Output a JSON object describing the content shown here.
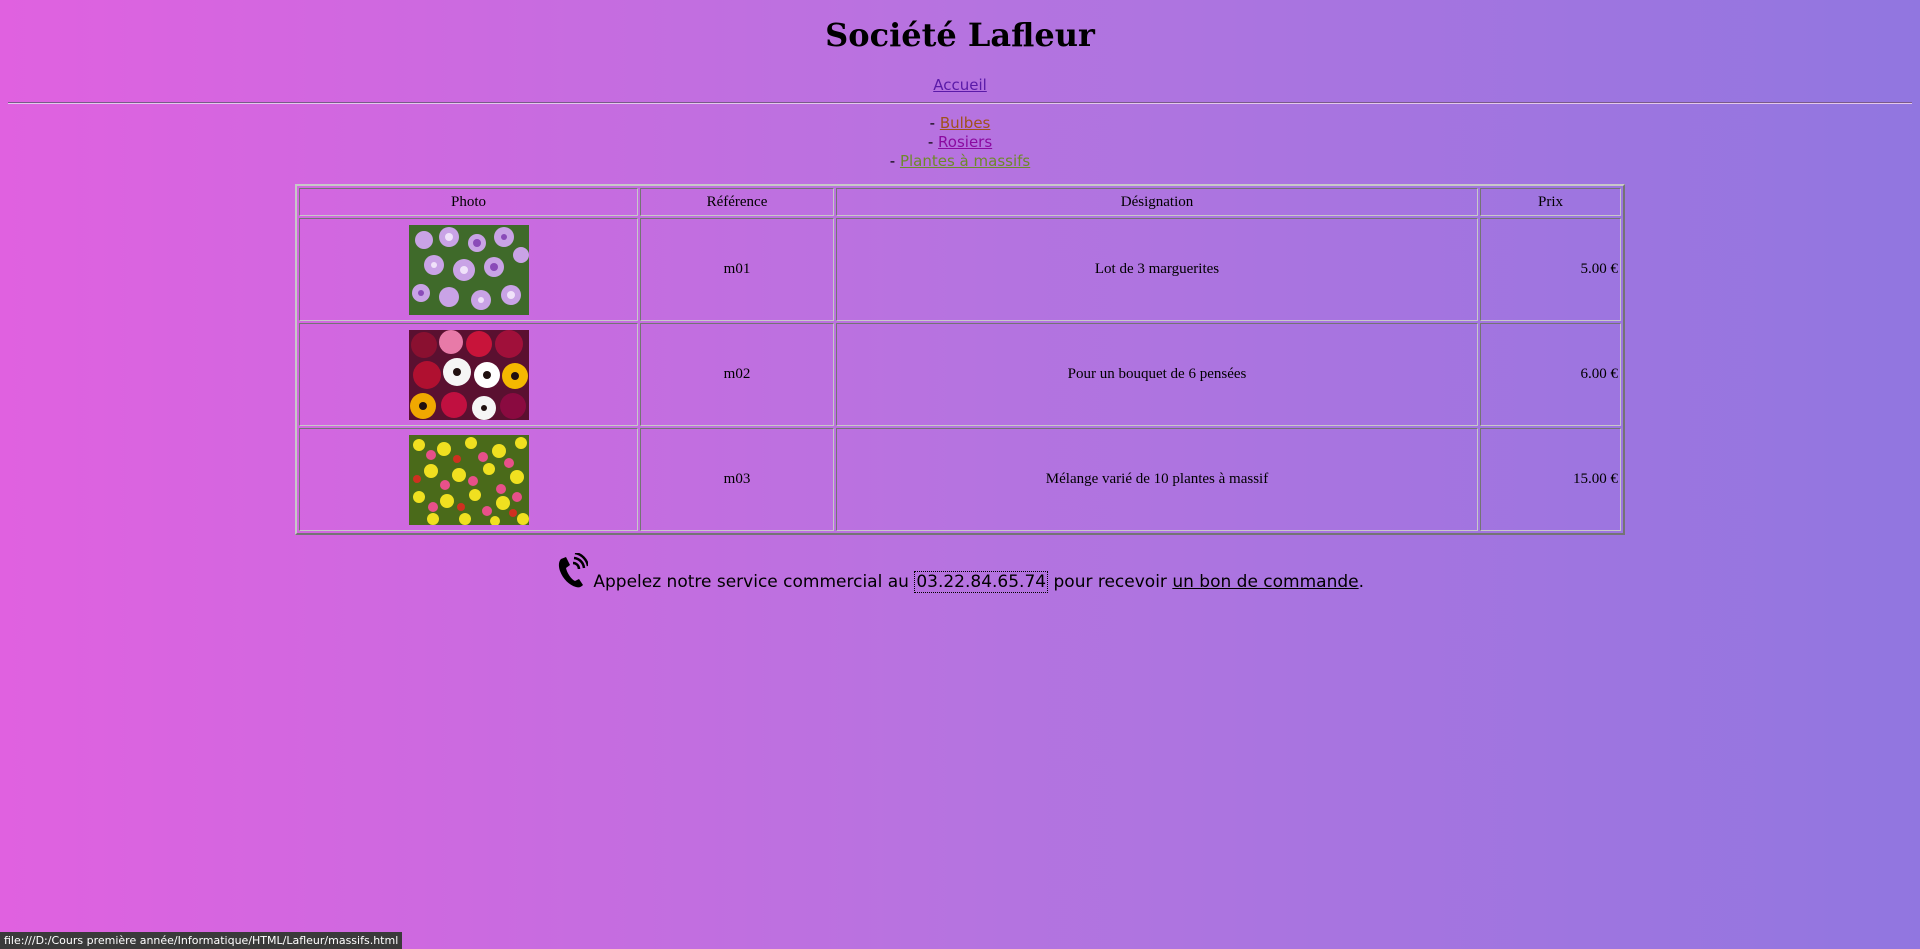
{
  "header": {
    "title": "Société Lafleur"
  },
  "nav": {
    "home_label": "Accueil"
  },
  "categories": [
    {
      "prefix": "- ",
      "label": "Bulbes"
    },
    {
      "prefix": "- ",
      "label": "Rosiers"
    },
    {
      "prefix": "- ",
      "label": "Plantes à massifs"
    }
  ],
  "table": {
    "headers": [
      "Photo",
      "Référence",
      "Désignation",
      "Prix"
    ],
    "rows": [
      {
        "ref": "m01",
        "designation": "Lot de 3 marguerites",
        "price": "5.00 €"
      },
      {
        "ref": "m02",
        "designation": "Pour un bouquet de 6 pensées",
        "price": "6.00 €"
      },
      {
        "ref": "m03",
        "designation": "Mélange varié de 10 plantes à massif",
        "price": "15.00 €"
      }
    ]
  },
  "contact": {
    "text_before": "Appelez notre service commercial au ",
    "phone": "03.22.84.65.74",
    "text_middle": " pour recevoir ",
    "link": "un bon de commande",
    "text_after": "."
  },
  "statusbar": {
    "url": "file:///D:/Cours première année/Informatique/HTML/Lafleur/massifs.html"
  },
  "colors": {
    "bg_left": "#e061e0",
    "bg_right": "#9176e0",
    "link_bulbes": "#a0521a",
    "link_rosiers": "#8b0aa0",
    "link_plantes": "#6e8a2a"
  }
}
